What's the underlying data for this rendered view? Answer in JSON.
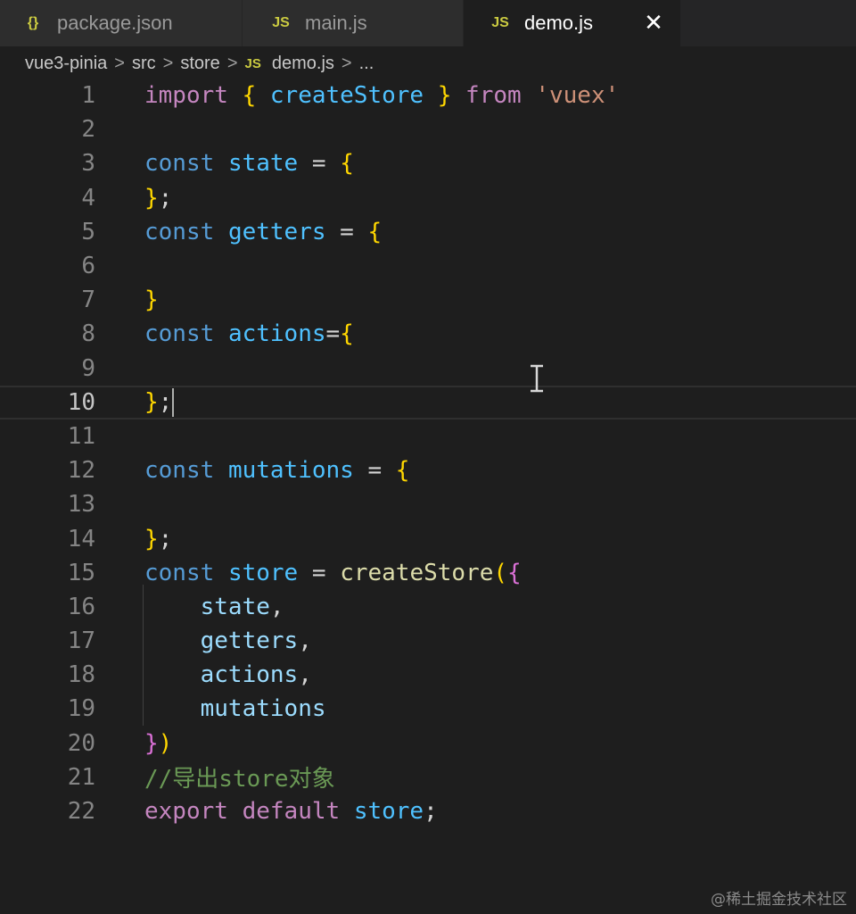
{
  "tabs": [
    {
      "icon": "{}",
      "label": "package.json",
      "active": false
    },
    {
      "icon": "JS",
      "label": "main.js",
      "active": false
    },
    {
      "icon": "JS",
      "label": "demo.js",
      "active": true,
      "close": "✕"
    }
  ],
  "breadcrumb": {
    "items": [
      "vue3-pinia",
      "src",
      "store"
    ],
    "file_icon": "JS",
    "file": "demo.js",
    "ellipsis": "...",
    "separator": ">"
  },
  "editor": {
    "current_line": 10,
    "line_numbers": [
      "1",
      "2",
      "3",
      "4",
      "5",
      "6",
      "7",
      "8",
      "9",
      "10",
      "11",
      "12",
      "13",
      "14",
      "15",
      "16",
      "17",
      "18",
      "19",
      "20",
      "21",
      "22"
    ],
    "lines": [
      {
        "n": "1",
        "tokens": [
          [
            "kwi",
            "import"
          ],
          [
            "op",
            " "
          ],
          [
            "br1",
            "{"
          ],
          [
            "op",
            " "
          ],
          [
            "var",
            "createStore"
          ],
          [
            "op",
            " "
          ],
          [
            "br1",
            "}"
          ],
          [
            "op",
            " "
          ],
          [
            "kwi",
            "from"
          ],
          [
            "op",
            " "
          ],
          [
            "str",
            "'vuex'"
          ]
        ]
      },
      {
        "n": "2",
        "tokens": []
      },
      {
        "n": "3",
        "tokens": [
          [
            "kw",
            "const"
          ],
          [
            "op",
            " "
          ],
          [
            "var",
            "state"
          ],
          [
            "op",
            " = "
          ],
          [
            "br1",
            "{"
          ]
        ]
      },
      {
        "n": "4",
        "tokens": [
          [
            "br1",
            "}"
          ],
          [
            "op",
            ";"
          ]
        ]
      },
      {
        "n": "5",
        "tokens": [
          [
            "kw",
            "const"
          ],
          [
            "op",
            " "
          ],
          [
            "var",
            "getters"
          ],
          [
            "op",
            " = "
          ],
          [
            "br1",
            "{"
          ]
        ]
      },
      {
        "n": "6",
        "tokens": []
      },
      {
        "n": "7",
        "tokens": [
          [
            "br1",
            "}"
          ]
        ]
      },
      {
        "n": "8",
        "tokens": [
          [
            "kw",
            "const"
          ],
          [
            "op",
            " "
          ],
          [
            "var",
            "actions"
          ],
          [
            "op",
            "="
          ],
          [
            "br1",
            "{"
          ]
        ]
      },
      {
        "n": "9",
        "tokens": []
      },
      {
        "n": "10",
        "tokens": [
          [
            "br1",
            "}"
          ],
          [
            "op",
            ";"
          ]
        ],
        "caret": true
      },
      {
        "n": "11",
        "tokens": []
      },
      {
        "n": "12",
        "tokens": [
          [
            "kw",
            "const"
          ],
          [
            "op",
            " "
          ],
          [
            "var",
            "mutations"
          ],
          [
            "op",
            " = "
          ],
          [
            "br1",
            "{"
          ]
        ]
      },
      {
        "n": "13",
        "tokens": []
      },
      {
        "n": "14",
        "tokens": [
          [
            "br1",
            "}"
          ],
          [
            "op",
            ";"
          ]
        ]
      },
      {
        "n": "15",
        "tokens": [
          [
            "kw",
            "const"
          ],
          [
            "op",
            " "
          ],
          [
            "var",
            "store"
          ],
          [
            "op",
            " = "
          ],
          [
            "fn",
            "createStore"
          ],
          [
            "br1",
            "("
          ],
          [
            "br2",
            "{"
          ]
        ]
      },
      {
        "n": "16",
        "tokens": [
          [
            "op",
            "    "
          ],
          [
            "prop",
            "state"
          ],
          [
            "op",
            ","
          ]
        ]
      },
      {
        "n": "17",
        "tokens": [
          [
            "op",
            "    "
          ],
          [
            "prop",
            "getters"
          ],
          [
            "op",
            ","
          ]
        ]
      },
      {
        "n": "18",
        "tokens": [
          [
            "op",
            "    "
          ],
          [
            "prop",
            "actions"
          ],
          [
            "op",
            ","
          ]
        ]
      },
      {
        "n": "19",
        "tokens": [
          [
            "op",
            "    "
          ],
          [
            "prop",
            "mutations"
          ]
        ]
      },
      {
        "n": "20",
        "tokens": [
          [
            "br2",
            "}"
          ],
          [
            "br1",
            ")"
          ]
        ]
      },
      {
        "n": "21",
        "tokens": [
          [
            "cmt",
            "//导出store对象"
          ]
        ]
      },
      {
        "n": "22",
        "tokens": [
          [
            "kwi",
            "export"
          ],
          [
            "op",
            " "
          ],
          [
            "kwi",
            "default"
          ],
          [
            "op",
            " "
          ],
          [
            "var",
            "store"
          ],
          [
            "op",
            ";"
          ]
        ]
      }
    ]
  },
  "watermark": "@稀土掘金技术社区",
  "colors": {
    "background": "#1e1e1e",
    "keyword": "#569cd6",
    "control_keyword": "#c586c0",
    "variable": "#4fc1ff",
    "function": "#dcdcaa",
    "string": "#ce9178",
    "bracket_gold": "#ffd700",
    "bracket_orchid": "#da70d6",
    "comment": "#6a9955",
    "js_icon": "#cbcb41"
  }
}
